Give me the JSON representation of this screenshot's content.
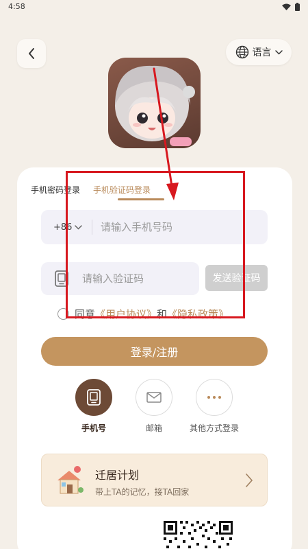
{
  "status_bar": {
    "time": "4:58"
  },
  "header": {
    "language_label": "语言"
  },
  "tabs": [
    {
      "label": "手机密码登录",
      "active": false
    },
    {
      "label": "手机验证码登录",
      "active": true
    }
  ],
  "phone": {
    "country_code": "+86",
    "placeholder": "请输入手机号码",
    "value": ""
  },
  "code": {
    "placeholder": "请输入验证码",
    "value": "",
    "send_label": "发送验证码"
  },
  "agreement": {
    "prefix": "同意",
    "user_agreement": "《用户协议》",
    "conjunction": "和",
    "privacy_policy": "《隐私政策》"
  },
  "login_button": "登录/注册",
  "methods": [
    {
      "label": "手机号",
      "icon": "tablet-icon",
      "selected": true
    },
    {
      "label": "邮箱",
      "icon": "mail-icon",
      "selected": false
    },
    {
      "label": "其他方式登录",
      "icon": "more-icon",
      "selected": false
    }
  ],
  "plan_banner": {
    "title": "迁居计划",
    "subtitle": "带上TA的记忆，接TA回家",
    "icon": "house-icon"
  },
  "colors": {
    "background": "#f4efe8",
    "accent": "#b98a5a",
    "login_button": "#c4955f",
    "selected_method": "#6d4a36",
    "annotation": "#d7181f"
  }
}
